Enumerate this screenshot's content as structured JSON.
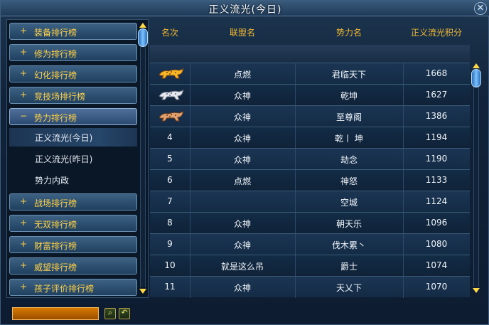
{
  "window": {
    "title": "正义流光(今日)",
    "close_glyph": "✕"
  },
  "sidebar": {
    "items": [
      {
        "label": "装备排行榜",
        "sign": "+"
      },
      {
        "label": "修为排行榜",
        "sign": "+"
      },
      {
        "label": "幻化排行榜",
        "sign": "+"
      },
      {
        "label": "竞技场排行榜",
        "sign": "+"
      },
      {
        "label": "势力排行榜",
        "sign": "−"
      },
      {
        "label": "战场排行榜",
        "sign": "+"
      },
      {
        "label": "无双排行榜",
        "sign": "+"
      },
      {
        "label": "财富排行榜",
        "sign": "+"
      },
      {
        "label": "威望排行榜",
        "sign": "+"
      },
      {
        "label": "孩子评价排行榜",
        "sign": "+"
      }
    ],
    "sub_items": [
      {
        "label": "正义流光(今日)",
        "selected": true
      },
      {
        "label": "正义流光(昨日)",
        "selected": false
      },
      {
        "label": "势力内政",
        "selected": false
      }
    ]
  },
  "table": {
    "headers": {
      "rank": "名次",
      "alliance": "联盟名",
      "faction": "势力名",
      "score": "正义流光积分"
    },
    "rows": [
      {
        "rank": "",
        "icon": "gold-leopard-icon",
        "alliance": "点燃",
        "faction": "君临天下",
        "score": "1668"
      },
      {
        "rank": "",
        "icon": "silver-leopard-icon",
        "alliance": "众神",
        "faction": "乾坤",
        "score": "1627"
      },
      {
        "rank": "",
        "icon": "bronze-leopard-icon",
        "alliance": "众神",
        "faction": "至尊阁",
        "score": "1386"
      },
      {
        "rank": "4",
        "alliance": "众神",
        "faction": "乾丨 坤",
        "score": "1194"
      },
      {
        "rank": "5",
        "alliance": "众神",
        "faction": "劫念",
        "score": "1190"
      },
      {
        "rank": "6",
        "alliance": "点燃",
        "faction": "神怒",
        "score": "1133"
      },
      {
        "rank": "7",
        "alliance": "",
        "faction": "空城",
        "score": "1124"
      },
      {
        "rank": "8",
        "alliance": "众神",
        "faction": "朝天乐",
        "score": "1096"
      },
      {
        "rank": "9",
        "alliance": "众神",
        "faction": "伐木累丶",
        "score": "1080"
      },
      {
        "rank": "10",
        "alliance": "就是这么吊",
        "faction": "爵士",
        "score": "1074"
      },
      {
        "rank": "11",
        "alliance": "众神",
        "faction": "天乂下",
        "score": "1070"
      }
    ]
  },
  "bottom": {
    "search_value": "",
    "search_icon_glyph": "⌕",
    "back_icon_glyph": "↶"
  },
  "colors": {
    "header_gold": "#f0b834",
    "sidebar_gold": "#ffd34c",
    "search_orange": "#d77a00"
  }
}
